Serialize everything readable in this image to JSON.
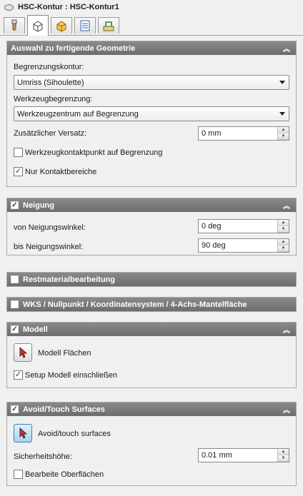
{
  "window": {
    "title": "HSC-Kontur : HSC-Kontur1"
  },
  "tabs": [
    {
      "icon": "tool-icon"
    },
    {
      "icon": "geometry-cube-icon"
    },
    {
      "icon": "heights-cube-icon"
    },
    {
      "icon": "passes-icon"
    },
    {
      "icon": "linking-icon"
    }
  ],
  "geometry": {
    "header": "Auswahl zu fertigende Geometrie",
    "boundary_label": "Begrenzungskontur:",
    "boundary_value": "Umriss (Sihoulette)",
    "tool_boundary_label": "Werkzeugbegrenzung:",
    "tool_boundary_value": "Werkzeugzentrum auf Begrenzung",
    "offset_label": "Zusätzlicher Versatz:",
    "offset_value": "0 mm",
    "contact_point_label": "Werkzeugkontaktpunkt auf Begrenzung",
    "contact_point_checked": false,
    "contact_only_label": "Nur Kontaktbereiche",
    "contact_only_checked": true
  },
  "slope": {
    "header": "Neigung",
    "checked": true,
    "from_label": "von Neigungswinkel:",
    "from_value": "0 deg",
    "to_label": "bis Neigungswinkel:",
    "to_value": "90 deg"
  },
  "rest_material": {
    "header": "Restmaterialbearbeitung",
    "checked": false
  },
  "wcs": {
    "header": "WKS / Nullpunkt / Koordinatensystem / 4-Achs-Mantelfläche",
    "checked": false
  },
  "model": {
    "header": "Modell",
    "checked": true,
    "surfaces_label": "Modell Flächen",
    "include_setup_label": "Setup Modell einschließen",
    "include_setup_checked": true
  },
  "avoid": {
    "header": "Avoid/Touch Surfaces",
    "checked": true,
    "surfaces_label": "Avoid/touch surfaces",
    "safety_label": "Sicherheitshöhe:",
    "safety_value": "0.01 mm",
    "edit_label": "Bearbeite Oberflächen",
    "edit_checked": false
  },
  "colors": {
    "header_bg": "#7a7a7a",
    "accent": "#1a3e8a",
    "select_blue": "#a8d4ee"
  }
}
